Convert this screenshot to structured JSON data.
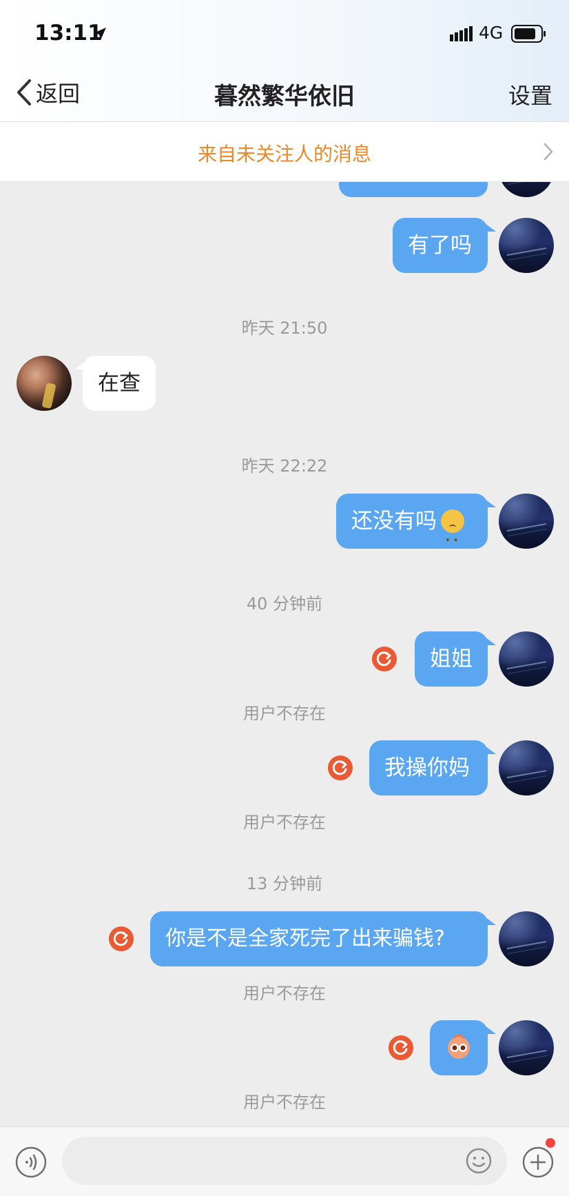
{
  "status_bar": {
    "time": "13:11",
    "network": "4G"
  },
  "nav": {
    "back_label": "返回",
    "title": "暮然繁华依旧",
    "settings_label": "设置"
  },
  "notice": {
    "text": "来自未关注人的消息"
  },
  "messages": {
    "partial_top_bubble": "",
    "m1": "有了吗",
    "ts1": "昨天 21:50",
    "m2": "在查",
    "ts2": "昨天 22:22",
    "m3": "还没有吗",
    "ts3": "40 分钟前",
    "m4": "姐姐",
    "m4_status": "用户不存在",
    "m5": "我操你妈",
    "m5_status": "用户不存在",
    "ts4": "13 分钟前",
    "m6": "你是不是全家死完了出来骗钱?",
    "m6_status": "用户不存在",
    "m7_status": "用户不存在"
  },
  "colors": {
    "my_bubble": "#5aa6f1",
    "notice_text": "#e8892b",
    "retry": "#e95a35",
    "badge": "#f0463c"
  },
  "icons": [
    "location-arrow-icon",
    "signal-icon",
    "battery-icon",
    "back-chevron-icon",
    "chevron-right-icon",
    "retry-icon",
    "voice-icon",
    "emoji-icon",
    "plus-icon",
    "sad-face-emoji",
    "sticker-icon"
  ]
}
